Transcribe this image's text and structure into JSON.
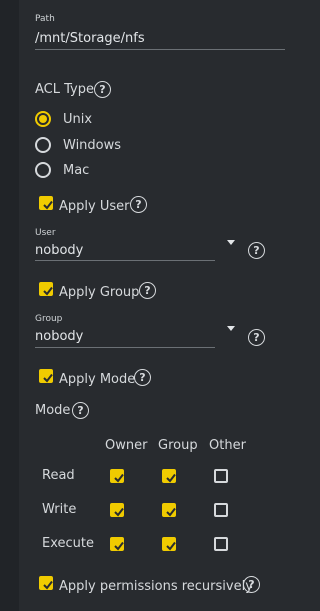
{
  "path": {
    "label": "Path",
    "value": "/mnt/Storage/nfs"
  },
  "acl": {
    "label": "ACL Type",
    "options": [
      "Unix",
      "Windows",
      "Mac"
    ],
    "selected": "Unix"
  },
  "apply_user": {
    "label": "Apply User",
    "checked": true
  },
  "user": {
    "label": "User",
    "value": "nobody"
  },
  "apply_group": {
    "label": "Apply Group",
    "checked": true
  },
  "group": {
    "label": "Group",
    "value": "nobody"
  },
  "apply_mode": {
    "label": "Apply Mode",
    "checked": true
  },
  "mode": {
    "label": "Mode",
    "columns": [
      "Owner",
      "Group",
      "Other"
    ],
    "rows": [
      {
        "label": "Read",
        "owner": true,
        "group": true,
        "other": false
      },
      {
        "label": "Write",
        "owner": true,
        "group": true,
        "other": false
      },
      {
        "label": "Execute",
        "owner": true,
        "group": true,
        "other": false
      }
    ]
  },
  "recursive": {
    "label": "Apply permissions recursively",
    "checked": true
  },
  "icons": {
    "help": "?"
  },
  "colors": {
    "accent": "#f0cb00",
    "background": "#282b2f",
    "text": "#d6d9dc"
  }
}
